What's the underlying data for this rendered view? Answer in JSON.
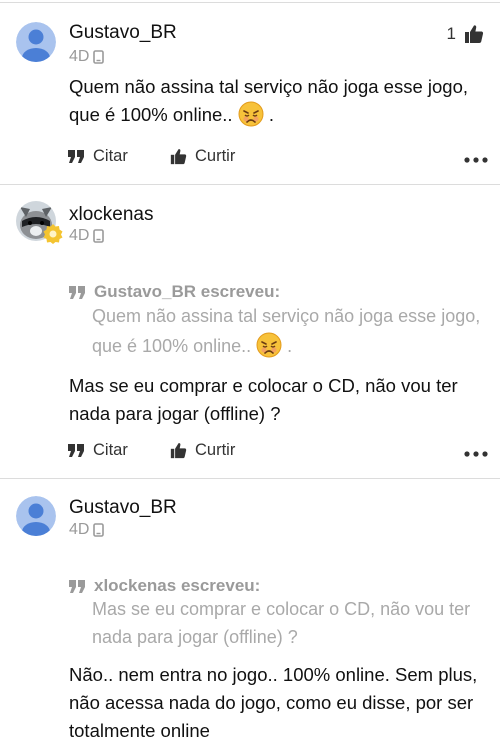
{
  "posts": [
    {
      "username": "Gustavo_BR",
      "time": "4D",
      "like_count": "1",
      "text": "Quem não assina tal serviço não joga esse jogo, que é 100% online..",
      "text_end": "."
    },
    {
      "username": "xlockenas",
      "time": "4D",
      "quote_author": "Gustavo_BR escreveu:",
      "quote_text": "Quem não assina tal serviço não joga esse jogo, que é 100% online..",
      "quote_end": ".",
      "text": "Mas se eu comprar e colocar o CD, não vou ter nada para jogar (offline) ?"
    },
    {
      "username": "Gustavo_BR",
      "time": "4D",
      "quote_author": "xlockenas escreveu:",
      "quote_text": "Mas se eu comprar e colocar o CD, não vou ter nada para jogar (offline) ?",
      "text": "Não.. nem entra no jogo.. 100% online. Sem plus, não acessa nada do jogo, como eu disse, por ser totalmente online"
    }
  ],
  "actions": {
    "quote_label": "Citar",
    "like_label": "Curtir"
  },
  "icons": {
    "quote": "quote-icon",
    "like": "thumbs-up-icon",
    "more": "more-options-icon",
    "device": "mobile-device-icon",
    "emoji": "weary-face-emoji"
  },
  "colors": {
    "avatar_bg": "#7ea5e8",
    "avatar_fg": "#4b7fd6",
    "badge": "#f4c431",
    "muted": "#9a9a9a",
    "divider": "#dcdcdc"
  }
}
